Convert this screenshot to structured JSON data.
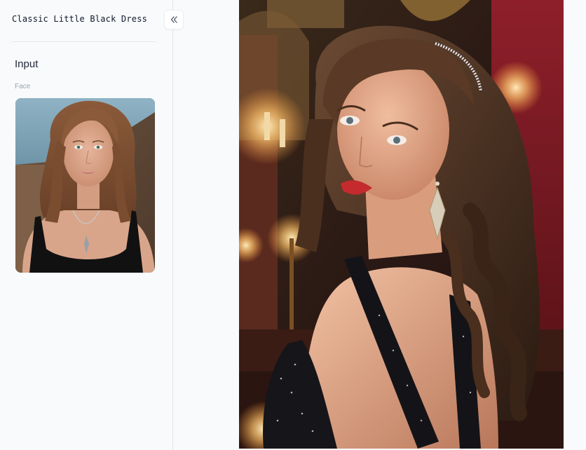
{
  "sidebar": {
    "title": "Classic Little Black Dress",
    "section_title": "Input",
    "face_label": "Face",
    "collapse_icon": "chevrons-left-icon"
  },
  "main": {
    "result_image": "generated-portrait"
  },
  "colors": {
    "background": "#f8fafc",
    "border": "#e5e7eb",
    "text": "#111827",
    "muted": "#9ca3af"
  }
}
